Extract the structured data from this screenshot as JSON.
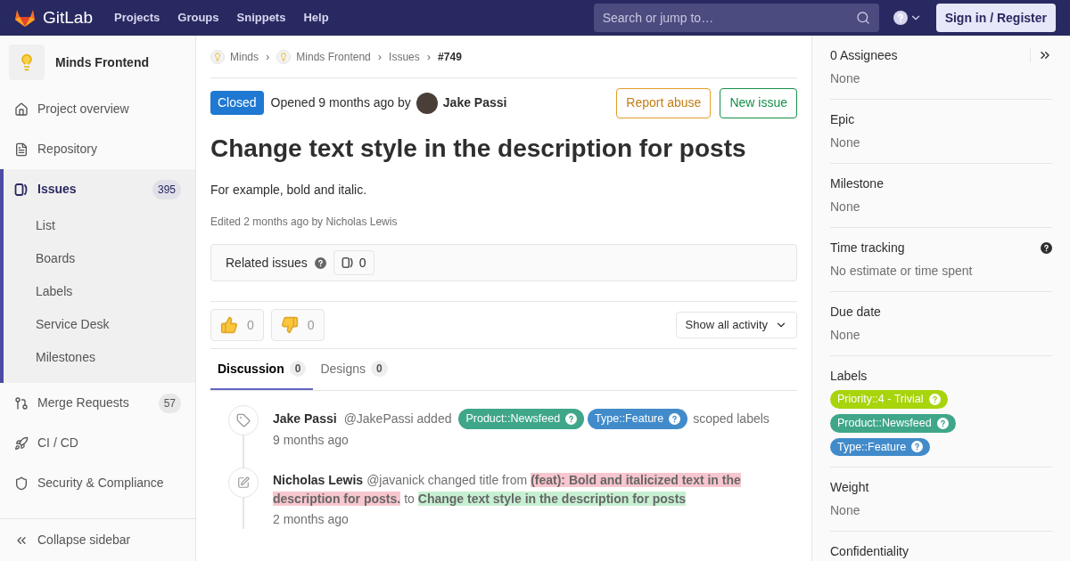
{
  "topnav": {
    "brand": "GitLab",
    "links": [
      "Projects",
      "Groups",
      "Snippets",
      "Help"
    ],
    "search": {
      "placeholder": "Search or jump to…"
    },
    "sign_in": "Sign in / Register"
  },
  "sidebar": {
    "project": "Minds Frontend",
    "items": [
      {
        "kind": "overview",
        "label": "Project overview",
        "selected": false
      },
      {
        "kind": "repository",
        "label": "Repository",
        "selected": false
      },
      {
        "kind": "issues",
        "label": "Issues",
        "count": "395",
        "selected": true,
        "children": [
          {
            "label": "List"
          },
          {
            "label": "Boards"
          },
          {
            "label": "Labels"
          },
          {
            "label": "Service Desk"
          },
          {
            "label": "Milestones"
          }
        ]
      },
      {
        "kind": "merge",
        "label": "Merge Requests",
        "count": "57",
        "selected": false
      },
      {
        "kind": "cicd",
        "label": "CI / CD",
        "selected": false
      },
      {
        "kind": "security",
        "label": "Security & Compliance",
        "selected": false
      }
    ],
    "collapse": "Collapse sidebar"
  },
  "breadcrumbs": [
    {
      "label": "Minds",
      "avatar": true,
      "separator": "›"
    },
    {
      "label": "Minds Frontend",
      "avatar": true,
      "separator": "›"
    },
    {
      "label": "Issues",
      "avatar": false,
      "separator": "›"
    },
    {
      "label": "#749",
      "avatar": false
    }
  ],
  "issue": {
    "status": "Closed",
    "opened": "Opened 9 months ago by",
    "author": "Jake Passi",
    "buttons": [
      {
        "kind": "warning",
        "label": "Report abuse"
      },
      {
        "kind": "success",
        "label": "New issue"
      }
    ],
    "title": "Change text style in the description for posts",
    "description": "For example, bold and italic.",
    "edited": "Edited 2 months ago by Nicholas Lewis"
  },
  "related": {
    "label": "Related issues",
    "count": "0"
  },
  "reactions": [
    {
      "kind": "up",
      "count": "0"
    },
    {
      "kind": "down",
      "count": "0"
    }
  ],
  "activity_filter": "Show all activity",
  "tabs": [
    {
      "label": "Discussion",
      "count": "0",
      "selected": true
    },
    {
      "label": "Designs",
      "count": "0",
      "selected": false
    }
  ],
  "timeline": [
    {
      "kind": "label",
      "author": "Jake Passi",
      "text": "@JakePassi added",
      "labels": [
        {
          "label": "Product::Newsfeed",
          "color": "#3fa68a"
        },
        {
          "label": "Type::Feature",
          "color": "#428bca"
        }
      ],
      "suffix": "scoped labels",
      "time": "9 months ago"
    },
    {
      "kind": "edit",
      "author": "Nicholas Lewis",
      "text": "@javanick changed title from",
      "old": "(feat): Bold and italicized text in the description for posts.",
      "joiner": "to",
      "new": "Change text style in the description for posts",
      "time": "2 months ago"
    }
  ],
  "right_sidebar": {
    "sections": [
      {
        "title": "0 Assignees",
        "value": "None"
      },
      {
        "title": "Epic",
        "value": "None"
      },
      {
        "title": "Milestone",
        "value": "None"
      },
      {
        "title": "Time tracking",
        "value": "No estimate or time spent",
        "help": true
      },
      {
        "title": "Due date",
        "value": "None"
      },
      {
        "title": "Labels",
        "labels": [
          {
            "label": "Priority::4 - Trivial",
            "color": "#a8d40c"
          },
          {
            "label": "Product::Newsfeed",
            "color": "#3fa68a"
          },
          {
            "label": "Type::Feature",
            "color": "#428bca"
          }
        ]
      },
      {
        "title": "Weight",
        "value": "None"
      },
      {
        "title": "Confidentiality"
      }
    ]
  }
}
